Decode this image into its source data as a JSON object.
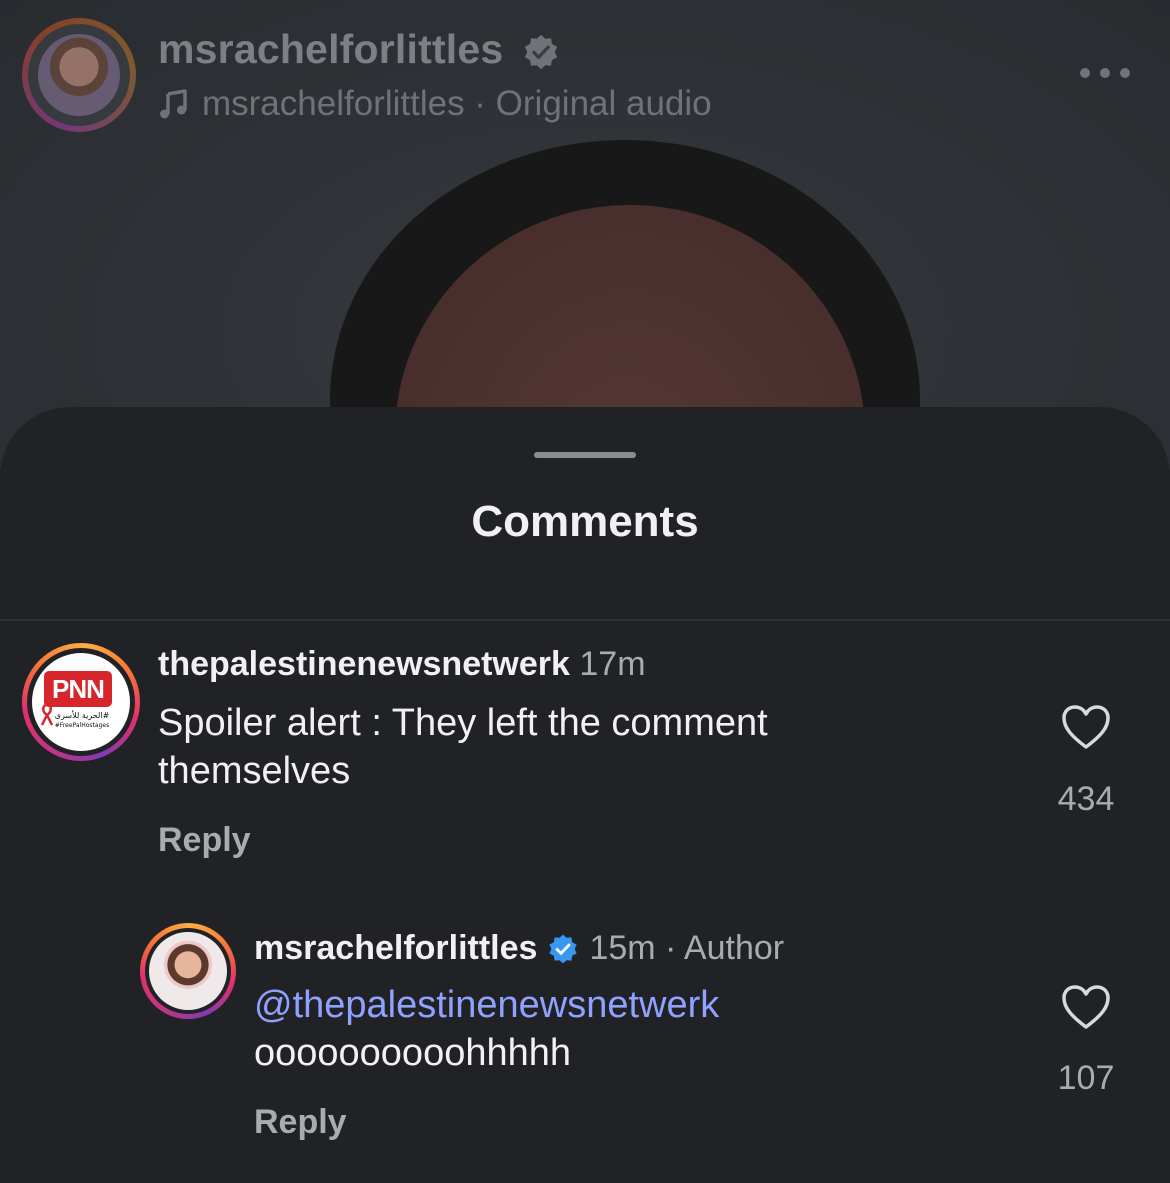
{
  "reel": {
    "username": "msrachelforlittles",
    "audio_text": "msrachelforlittles · Original audio",
    "icons": [
      "verified-badge-icon",
      "music-note-icon",
      "more-options-icon"
    ]
  },
  "sheet": {
    "title": "Comments"
  },
  "comments": [
    {
      "username": "thepalestinenewsnetwerk",
      "time": "17m",
      "body": "Spoiler alert : They left the comment themselves",
      "reply_label": "Reply",
      "likes": "434",
      "avatar_logo_text": "PNN",
      "avatar_arabic_text": "الحرية للأسرى#",
      "avatar_tag_text": "#FreePalHostages"
    },
    {
      "username": "msrachelforlittles",
      "time_meta": "15m · Author",
      "mention": "@thepalestinenewsnetwerk",
      "body": "oooooooooohhhhh",
      "reply_label": "Reply",
      "likes": "107"
    }
  ],
  "colors": {
    "sheet_bg": "#212226",
    "mention": "#8fa2ff",
    "verified": "#3897f0"
  }
}
